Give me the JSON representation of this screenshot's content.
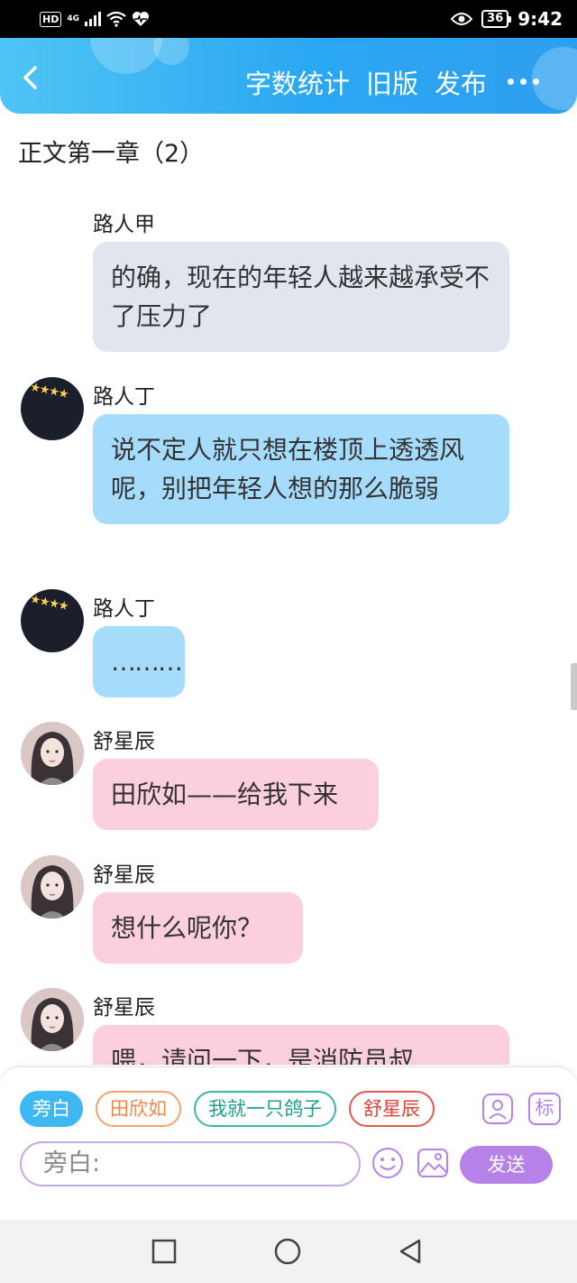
{
  "status_bar": {
    "hd": "HD",
    "network": "4G",
    "battery": "36",
    "time": "9:42"
  },
  "header": {
    "actions": [
      "字数统计",
      "旧版",
      "发布"
    ],
    "gradient_colors": [
      "#4fc4f5",
      "#2e9ff0"
    ]
  },
  "chapter_title": "正文第一章（2）",
  "messages": [
    {
      "speaker": "路人甲",
      "text": "的确，现在的年轻人越来越承受不了压力了",
      "bubble_color": "#e1e5ed",
      "avatar": "none"
    },
    {
      "speaker": "路人丁",
      "text": "说不定人就只想在楼顶上透透风呢，别把年轻人想的那么脆弱",
      "bubble_color": "#a6dcfb",
      "avatar": "dark-stars"
    },
    {
      "speaker": "路人丁",
      "text": "………",
      "bubble_color": "#a6dcfb",
      "avatar": "dark-stars"
    },
    {
      "speaker": "舒星辰",
      "text": "田欣如——给我下来",
      "bubble_color": "#fbcfdb",
      "avatar": "girl-portrait"
    },
    {
      "speaker": "舒星辰",
      "text": "想什么呢你？",
      "bubble_color": "#fbcfdb",
      "avatar": "girl-portrait"
    },
    {
      "speaker": "舒星辰",
      "text": "喂，请问一下，是消防员叔",
      "bubble_color": "#fbcfdb",
      "avatar": "girl-portrait"
    }
  ],
  "roles": [
    {
      "label": "旁白",
      "color": "#3db8f3",
      "selected": true
    },
    {
      "label": "田欣如",
      "color": "#ee8a48",
      "selected": false
    },
    {
      "label": "我就一只鸽子",
      "color": "#1ea08f",
      "selected": false
    },
    {
      "label": "舒星辰",
      "color": "#d94437",
      "selected": false
    }
  ],
  "tools": {
    "role_manage_icon": "user-card-icon",
    "mark_label": "标",
    "emoji_icon": "emoji-icon",
    "image_icon": "image-icon"
  },
  "input": {
    "placeholder": "旁白:"
  },
  "send_label": "发送",
  "nav_icons": [
    "square-icon",
    "circle-icon",
    "triangle-back-icon"
  ]
}
